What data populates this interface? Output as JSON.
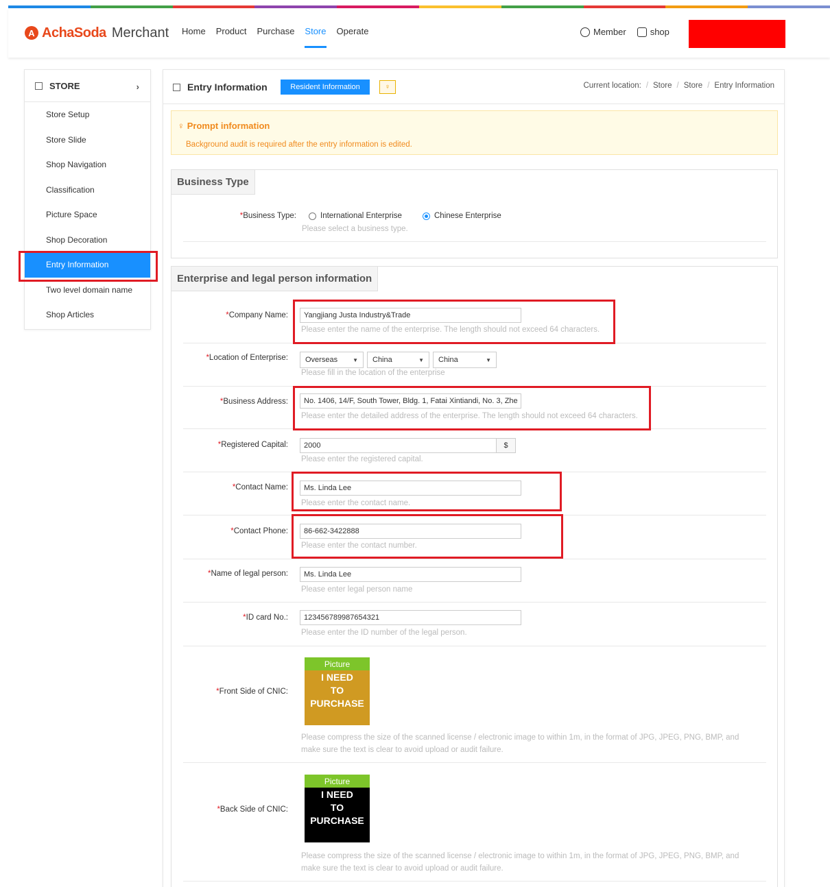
{
  "colors": {
    "accent": "#1890ff",
    "brand": "#e8481b",
    "highlight_red": "#e01b24",
    "prompt_text": "#f08a1d",
    "topbar": [
      "#1e88e5",
      "#43a047",
      "#e53935",
      "#8e44ad",
      "#d81b60",
      "#fbc02d",
      "#43a047",
      "#e53935",
      "#f39c12",
      "#7b8fd1"
    ]
  },
  "header": {
    "logo_text": "AchaSoda",
    "logo_sub": "Merchant",
    "nav": [
      "Home",
      "Product",
      "Purchase",
      "Store",
      "Operate"
    ],
    "active_nav": "Store",
    "member_label": "Member",
    "shop_label": "shop"
  },
  "sidebar": {
    "title": "STORE",
    "items": [
      "Store Setup",
      "Store Slide",
      "Shop Navigation",
      "Classification",
      "Picture Space",
      "Shop Decoration",
      "Entry Information",
      "Two level domain name",
      "Shop Articles"
    ],
    "active_item": "Entry Information"
  },
  "main": {
    "title": "Entry Information",
    "resident_button": "Resident Information",
    "breadcrumb": {
      "prefix": "Current location:",
      "items": [
        "Store",
        "Store",
        "Entry Information"
      ]
    },
    "prompt": {
      "title": "Prompt information",
      "text": "Background audit is required after the entry information is edited."
    },
    "business_type": {
      "section_title": "Business Type",
      "label": "Business Type:",
      "options": [
        "International Enterprise",
        "Chinese Enterprise"
      ],
      "selected": "Chinese Enterprise",
      "hint": "Please select a business type."
    },
    "enterprise": {
      "section_title": "Enterprise and legal person information",
      "company_name": {
        "label": "Company Name:",
        "value": "Yangjiang Justa Industry&Trade",
        "hint": "Please enter the name of the enterprise. The length should not exceed 64 characters."
      },
      "location": {
        "label": "Location of Enterprise:",
        "values": [
          "Overseas",
          "China",
          "China"
        ],
        "hint": "Please fill in the location of the enterprise"
      },
      "business_address": {
        "label": "Business Address:",
        "value": "No. 1406, 14/F, South Tower, Bldg. 1, Fatai Xintiandi, No. 3, Zhe",
        "hint": "Please enter the detailed address of the enterprise. The length should not exceed 64 characters."
      },
      "registered_capital": {
        "label": "Registered Capital:",
        "value": "2000",
        "unit": "$",
        "hint": "Please enter the registered capital."
      },
      "contact_name": {
        "label": "Contact Name:",
        "value": "Ms. Linda Lee",
        "hint": "Please enter the contact name."
      },
      "contact_phone": {
        "label": "Contact Phone:",
        "value": "86-662-3422888",
        "hint": "Please enter the contact number."
      },
      "legal_person": {
        "label": "Name of legal person:",
        "value": "Ms. Linda Lee",
        "hint": "Please enter legal person name"
      },
      "id_card": {
        "label": "ID card No.:",
        "value": "123456789987654321",
        "hint": "Please enter the ID number of the legal person."
      },
      "front_cnic": {
        "label": "Front Side of CNIC:",
        "pic_label": "Picture",
        "pic_text": [
          "I NEED",
          "TO",
          "PURCHASE"
        ],
        "hint_line1": "Please compress the size of the scanned license / electronic image to within 1m, in the format of JPG, JPEG, PNG, BMP, and",
        "hint_line2": "make sure the text is clear to avoid upload or audit failure."
      },
      "back_cnic": {
        "label": "Back Side of CNIC:",
        "pic_label": "Picture",
        "pic_text": [
          "I NEED",
          "TO",
          "PURCHASE"
        ],
        "hint_line1": "Please compress the size of the scanned license / electronic image to within 1m, in the format of JPG, JPEG, PNG, BMP, and",
        "hint_line2": "make sure the text is clear to avoid upload or audit failure."
      }
    }
  }
}
